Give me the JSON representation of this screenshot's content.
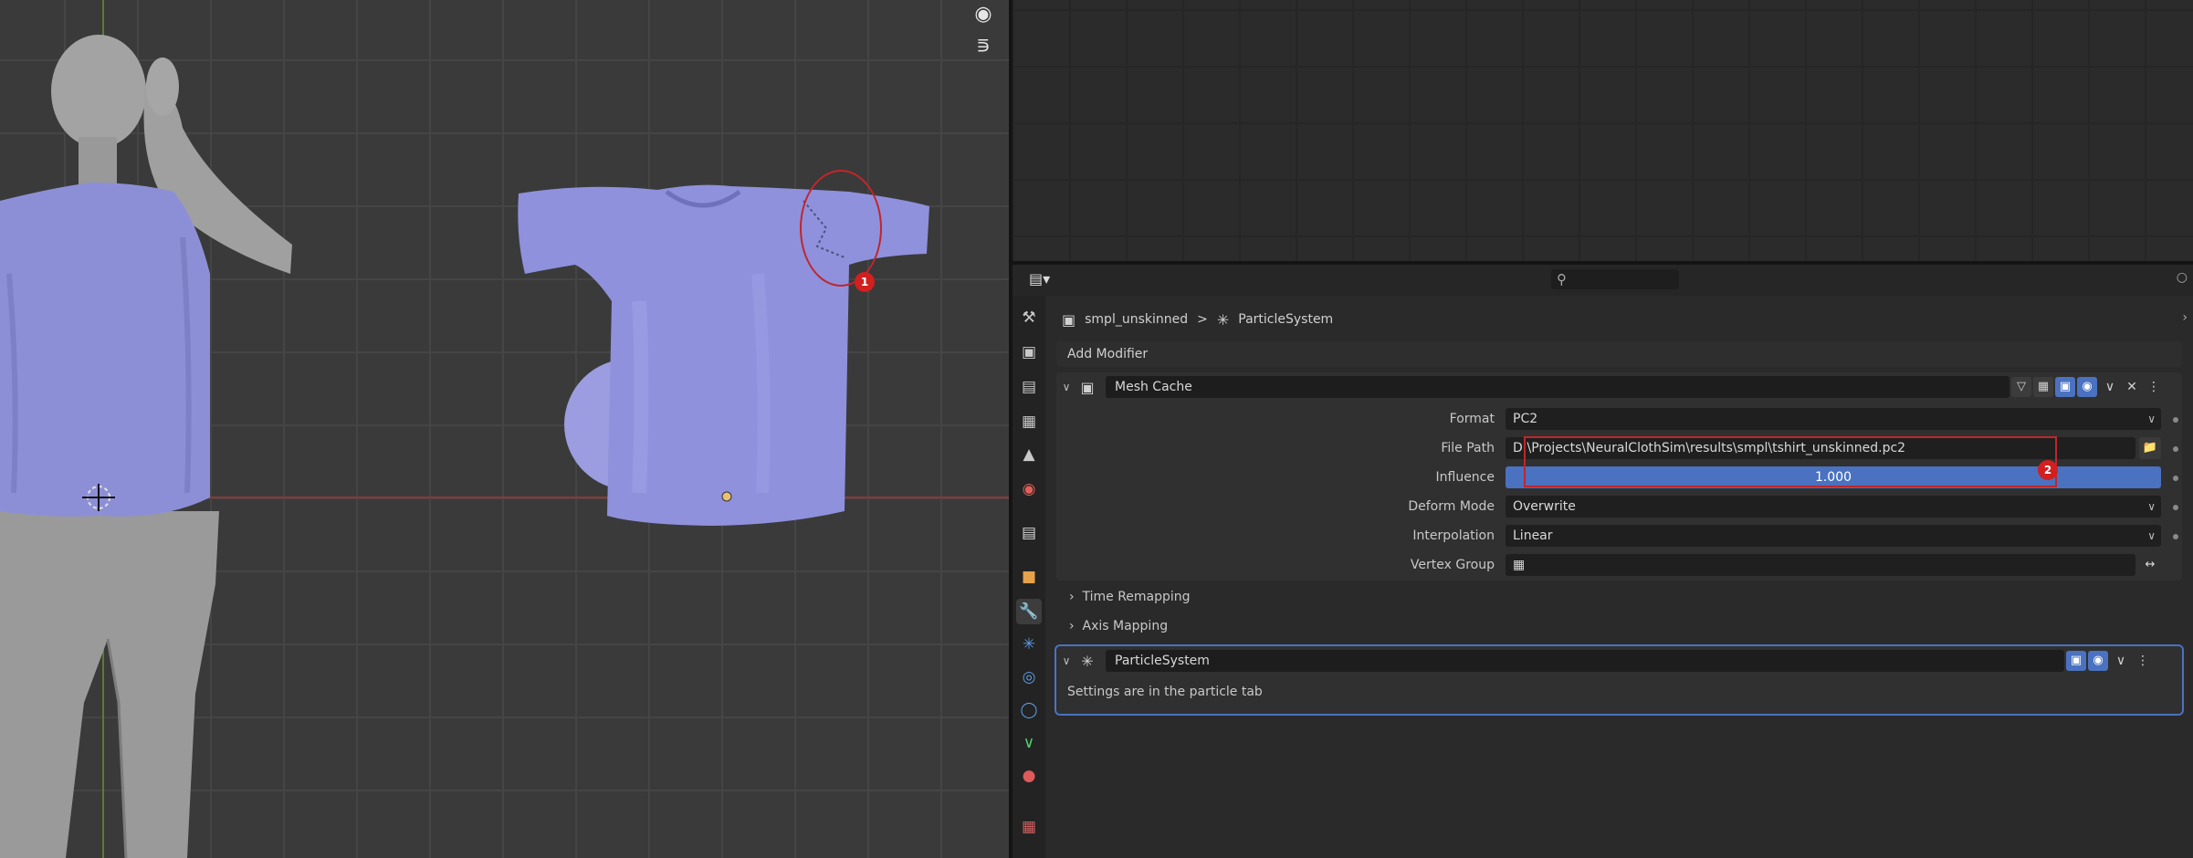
{
  "viewport": {
    "tools": [
      {
        "icon": "camera-icon"
      },
      {
        "icon": "grid-icon"
      }
    ],
    "annotations": [
      {
        "label": "1"
      }
    ]
  },
  "properties": {
    "header": {
      "editor_type_icon": "properties-editor-icon",
      "search_placeholder": ""
    },
    "tabs": [
      {
        "name": "tool",
        "icon": "tool-icon"
      },
      {
        "name": "render",
        "icon": "render-icon"
      },
      {
        "name": "output",
        "icon": "output-icon"
      },
      {
        "name": "view-layer",
        "icon": "view-layer-icon"
      },
      {
        "name": "scene",
        "icon": "scene-icon"
      },
      {
        "name": "world",
        "icon": "world-icon"
      },
      {
        "name": "collection",
        "icon": "collection-icon"
      },
      {
        "name": "object",
        "icon": "object-icon"
      },
      {
        "name": "modifiers",
        "icon": "wrench-icon",
        "active": true
      },
      {
        "name": "particles",
        "icon": "particles-icon"
      },
      {
        "name": "physics",
        "icon": "physics-icon"
      },
      {
        "name": "constraints",
        "icon": "constraints-icon"
      },
      {
        "name": "data",
        "icon": "data-icon"
      },
      {
        "name": "material",
        "icon": "material-icon"
      },
      {
        "name": "texture",
        "icon": "texture-icon"
      }
    ],
    "breadcrumb": {
      "object": "smpl_unskinned",
      "separator": ">",
      "item": "ParticleSystem"
    },
    "add_modifier": "Add Modifier",
    "mesh_cache": {
      "name": "Mesh Cache",
      "fields": {
        "format": {
          "label": "Format",
          "value": "PC2"
        },
        "file_path": {
          "label": "File Path",
          "value": "D:\\Projects\\NeuralClothSim\\results\\smpl\\tshirt_unskinned.pc2"
        },
        "influence": {
          "label": "Influence",
          "value": "1.000"
        },
        "deform_mode": {
          "label": "Deform Mode",
          "value": "Overwrite"
        },
        "interpolation": {
          "label": "Interpolation",
          "value": "Linear"
        },
        "vertex_group": {
          "label": "Vertex Group",
          "value": ""
        }
      },
      "subpanels": [
        "Time Remapping",
        "Axis Mapping"
      ],
      "annotation": "2"
    },
    "particle_system": {
      "name": "ParticleSystem",
      "note": "Settings are in the particle tab"
    },
    "accent": "#4a72c0",
    "marker_color": "#d21f1f"
  }
}
